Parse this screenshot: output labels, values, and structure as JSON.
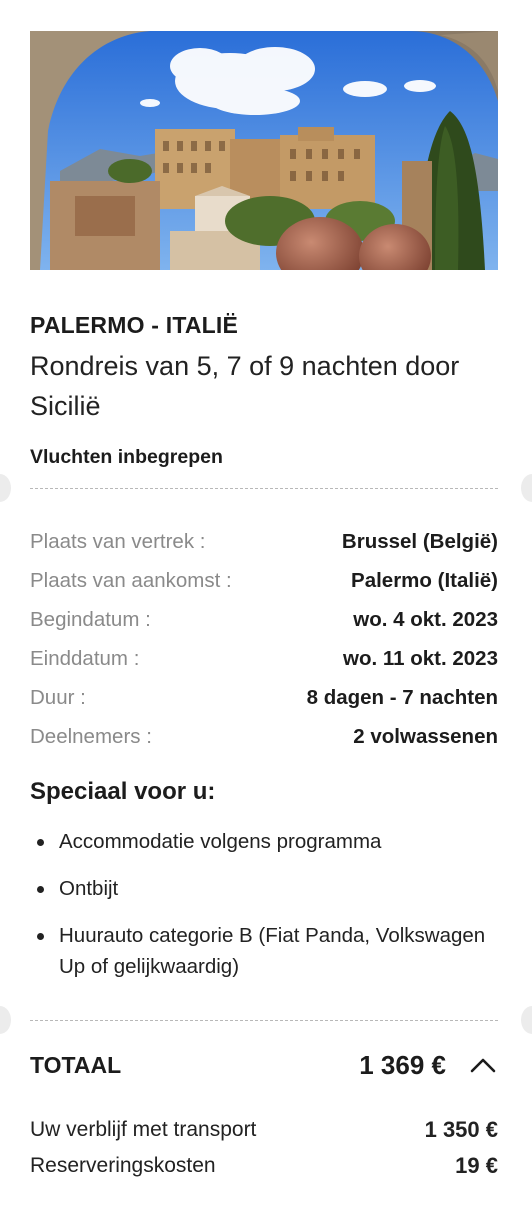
{
  "trip": {
    "destination": "PALERMO - ITALIË",
    "title": "Rondreis van 5, 7 of 9 nachten door Sicilië",
    "flights_label": "Vluchten inbegrepen"
  },
  "details": [
    {
      "label": "Plaats van vertrek :",
      "value": "Brussel (België)"
    },
    {
      "label": "Plaats van aankomst :",
      "value": "Palermo (Italië)"
    },
    {
      "label": "Begindatum :",
      "value": "wo. 4 okt. 2023"
    },
    {
      "label": "Einddatum :",
      "value": "wo. 11 okt. 2023"
    },
    {
      "label": "Duur :",
      "value": "8 dagen - 7 nachten"
    },
    {
      "label": "Deelnemers :",
      "value": "2 volwassenen"
    }
  ],
  "special": {
    "title": "Speciaal voor u:",
    "items": [
      "Accommodatie volgens programma",
      "Ontbijt",
      "Huurauto categorie B (Fiat Panda, Volkswagen Up of gelijkwaardig)"
    ]
  },
  "total": {
    "label": "TOTAAL",
    "value": "1 369 €",
    "toggle_icon": "chevron-up-icon"
  },
  "breakdown": [
    {
      "label": "Uw verblijf met transport",
      "value": "1 350 €"
    },
    {
      "label": "Reserveringskosten",
      "value": "19 €"
    }
  ]
}
